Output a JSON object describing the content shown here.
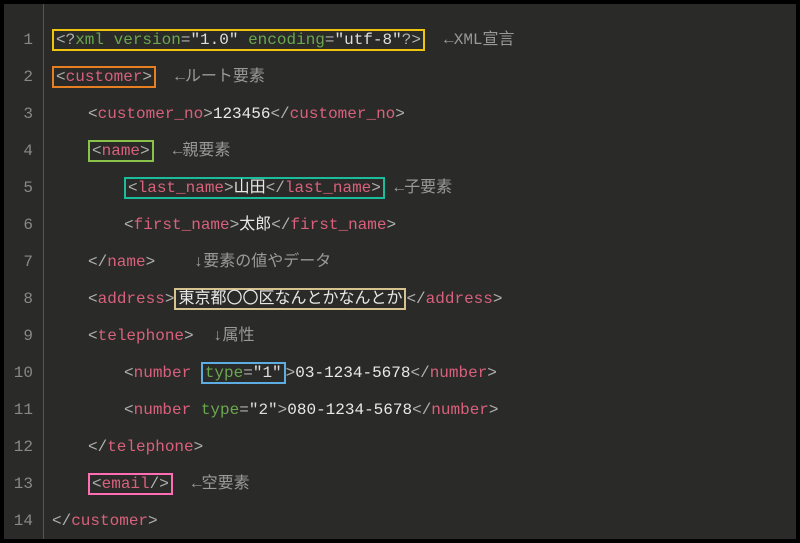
{
  "lineNumbers": [
    "1",
    "2",
    "3",
    "4",
    "5",
    "6",
    "7",
    "8",
    "9",
    "10",
    "11",
    "12",
    "13",
    "14"
  ],
  "xmlDecl": {
    "open": "<?",
    "xml": "xml",
    "versionKey": "version",
    "versionVal": "\"1.0\"",
    "encodingKey": "encoding",
    "encodingVal": "\"utf-8\"",
    "close": "?>"
  },
  "tags": {
    "customer": "customer",
    "customer_no": "customer_no",
    "name": "name",
    "last_name": "last_name",
    "first_name": "first_name",
    "address": "address",
    "telephone": "telephone",
    "number": "number",
    "email": "email"
  },
  "attrs": {
    "type": "type",
    "val1": "\"1\"",
    "val2": "\"2\""
  },
  "text": {
    "customer_no": "123456",
    "last_name": "山田",
    "first_name": "太郎",
    "address": "東京都〇〇区なんとかなんとか",
    "phone1": "03-1234-5678",
    "phone2": "080-1234-5678"
  },
  "sym": {
    "lt": "<",
    "gt": ">",
    "lts": "</",
    "slashgt": "/>",
    "eq": "=",
    "sp": " "
  },
  "annot": {
    "xmlDecl": "←XML宣言",
    "root": "←ルート要素",
    "parent": "←親要素",
    "child": "←子要素",
    "value": "↓要素の値やデータ",
    "attr": "↓属性",
    "empty": "←空要素"
  }
}
